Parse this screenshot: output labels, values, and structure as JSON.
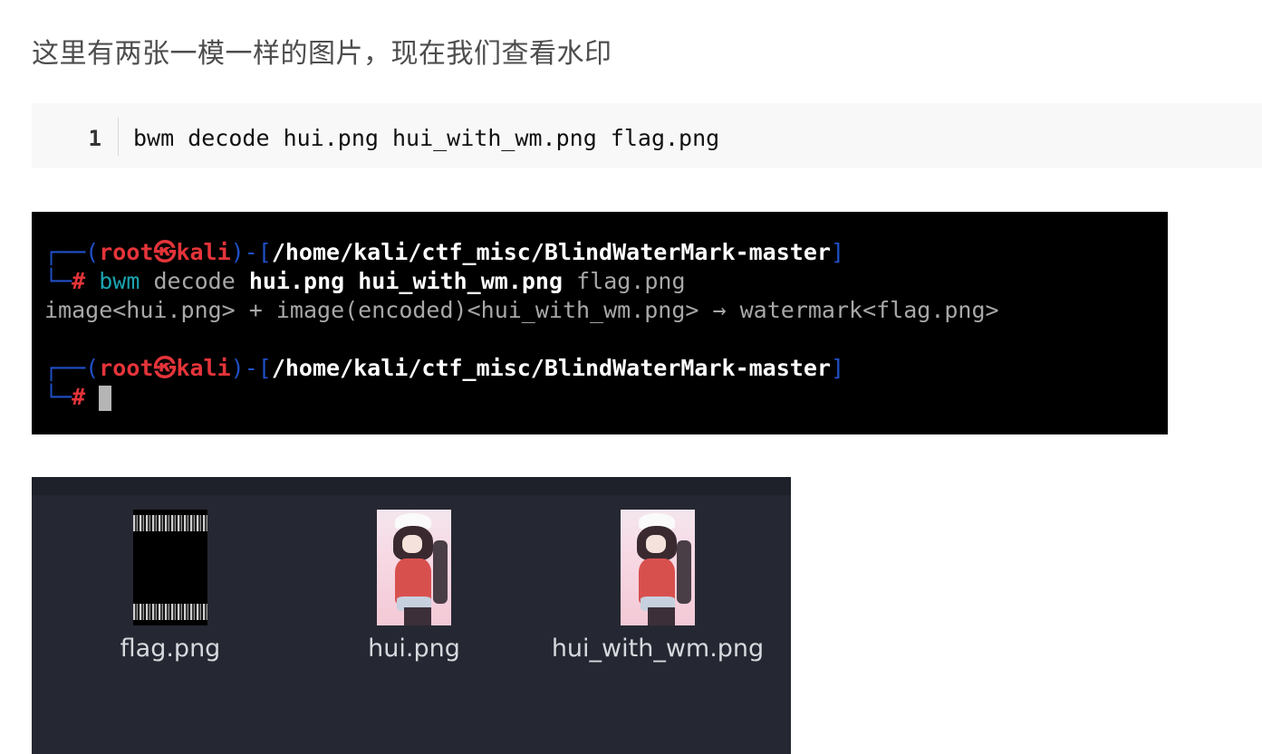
{
  "intro_text": "这里有两张一模一样的图片，现在我们查看水印",
  "code_block": {
    "line_number": "1",
    "code": "bwm decode hui.png hui_with_wm.png flag.png"
  },
  "terminal": {
    "prompt_open": "┌──(",
    "user": "root",
    "at_symbol": "㉿",
    "host": "kali",
    "dash_bracket": ")-[",
    "path": "/home/kali/ctf_misc/BlindWaterMark-master",
    "bracket_close": "]",
    "prompt_hash_prefix": "└─",
    "hash": "#",
    "cmd_name": "bwm",
    "cmd_action": "decode",
    "cmd_arg1": "hui.png",
    "cmd_arg2": "hui_with_wm.png",
    "cmd_arg3": "flag.png",
    "output": "image<hui.png> + image(encoded)<hui_with_wm.png> → watermark<flag.png>"
  },
  "file_manager": {
    "files": [
      {
        "name": "flag.png",
        "icon": "flag-thumbnail-icon"
      },
      {
        "name": "hui.png",
        "icon": "anime-image-thumbnail-icon"
      },
      {
        "name": "hui_with_wm.png",
        "icon": "anime-image-thumbnail-icon"
      }
    ]
  }
}
